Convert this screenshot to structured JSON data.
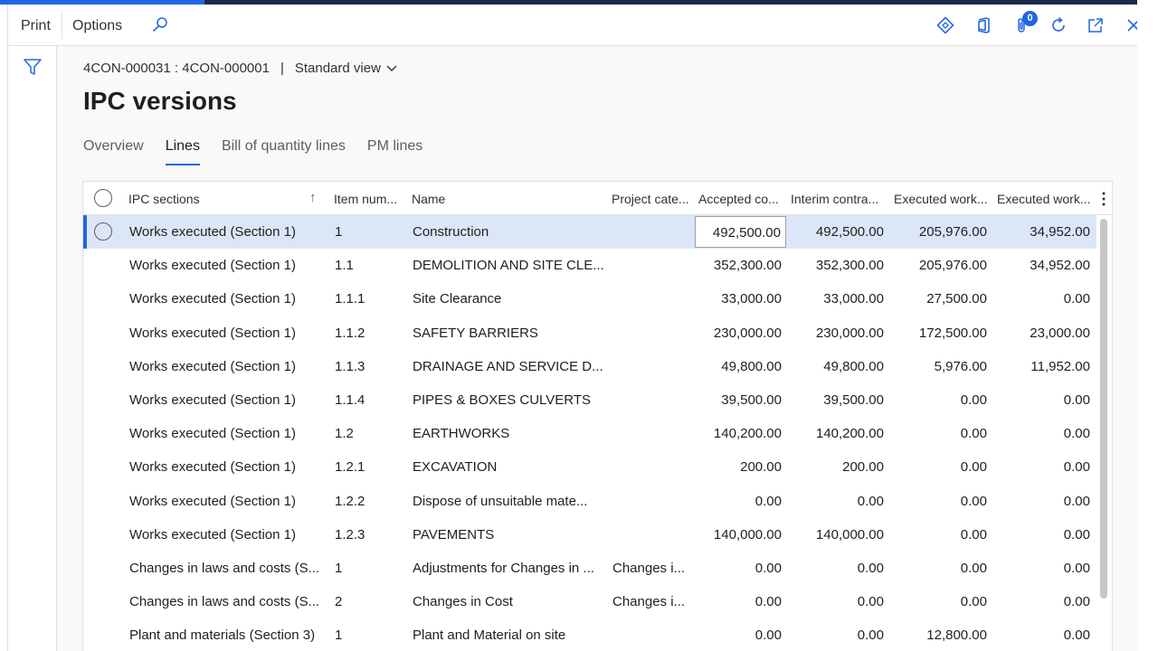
{
  "command_bar": {
    "print_label": "Print",
    "options_label": "Options",
    "notification_count": "0"
  },
  "caption": {
    "record_id": "4CON-000031 : 4CON-000001",
    "separator": "|",
    "view_label": "Standard view"
  },
  "page_title": "IPC versions",
  "tabs": [
    {
      "label": "Overview"
    },
    {
      "label": "Lines"
    },
    {
      "label": "Bill of quantity lines"
    },
    {
      "label": "PM lines"
    }
  ],
  "grid": {
    "columns": [
      "IPC sections",
      "Item num...",
      "Name",
      "Project cate...",
      "Accepted co...",
      "Interim contra...",
      "Executed work...",
      "Executed work..."
    ],
    "rows": [
      [
        "Works executed (Section 1)",
        "1",
        "Construction",
        "",
        "492,500.00",
        "492,500.00",
        "205,976.00",
        "34,952.00"
      ],
      [
        "Works executed (Section 1)",
        "1.1",
        "DEMOLITION AND SITE CLE...",
        "",
        "352,300.00",
        "352,300.00",
        "205,976.00",
        "34,952.00"
      ],
      [
        "Works executed (Section 1)",
        "1.1.1",
        "Site Clearance",
        "",
        "33,000.00",
        "33,000.00",
        "27,500.00",
        "0.00"
      ],
      [
        "Works executed (Section 1)",
        "1.1.2",
        "SAFETY BARRIERS",
        "",
        "230,000.00",
        "230,000.00",
        "172,500.00",
        "23,000.00"
      ],
      [
        "Works executed (Section 1)",
        "1.1.3",
        "DRAINAGE AND SERVICE D...",
        "",
        "49,800.00",
        "49,800.00",
        "5,976.00",
        "11,952.00"
      ],
      [
        "Works executed (Section 1)",
        "1.1.4",
        "PIPES & BOXES CULVERTS",
        "",
        "39,500.00",
        "39,500.00",
        "0.00",
        "0.00"
      ],
      [
        "Works executed (Section 1)",
        "1.2",
        "EARTHWORKS",
        "",
        "140,200.00",
        "140,200.00",
        "0.00",
        "0.00"
      ],
      [
        "Works executed (Section 1)",
        "1.2.1",
        "EXCAVATION",
        "",
        "200.00",
        "200.00",
        "0.00",
        "0.00"
      ],
      [
        "Works executed (Section 1)",
        "1.2.2",
        "Dispose of unsuitable  mate...",
        "",
        "0.00",
        "0.00",
        "0.00",
        "0.00"
      ],
      [
        "Works executed (Section 1)",
        "1.2.3",
        "PAVEMENTS",
        "",
        "140,000.00",
        "140,000.00",
        "0.00",
        "0.00"
      ],
      [
        "Changes in laws and costs (S...",
        "1",
        "Adjustments for Changes in ...",
        "Changes i...",
        "0.00",
        "0.00",
        "0.00",
        "0.00"
      ],
      [
        "Changes in laws and costs (S...",
        "2",
        "Changes in Cost",
        "Changes i...",
        "0.00",
        "0.00",
        "0.00",
        "0.00"
      ],
      [
        "Plant and materials (Section 3)",
        "1",
        "Plant and Material on site",
        "",
        "0.00",
        "0.00",
        "12,800.00",
        "0.00"
      ]
    ]
  },
  "colors": {
    "accent": "#2266e3",
    "top_strip": "#1b2a4a",
    "selected_row": "#dce6f9"
  },
  "icons": [
    "search-icon",
    "diamond-icon",
    "office-icon",
    "attachment-icon",
    "refresh-icon",
    "open-new-window-icon",
    "close-icon",
    "filter-icon",
    "chevron-down-icon",
    "sort-ascending-icon",
    "more-options-icon"
  ]
}
